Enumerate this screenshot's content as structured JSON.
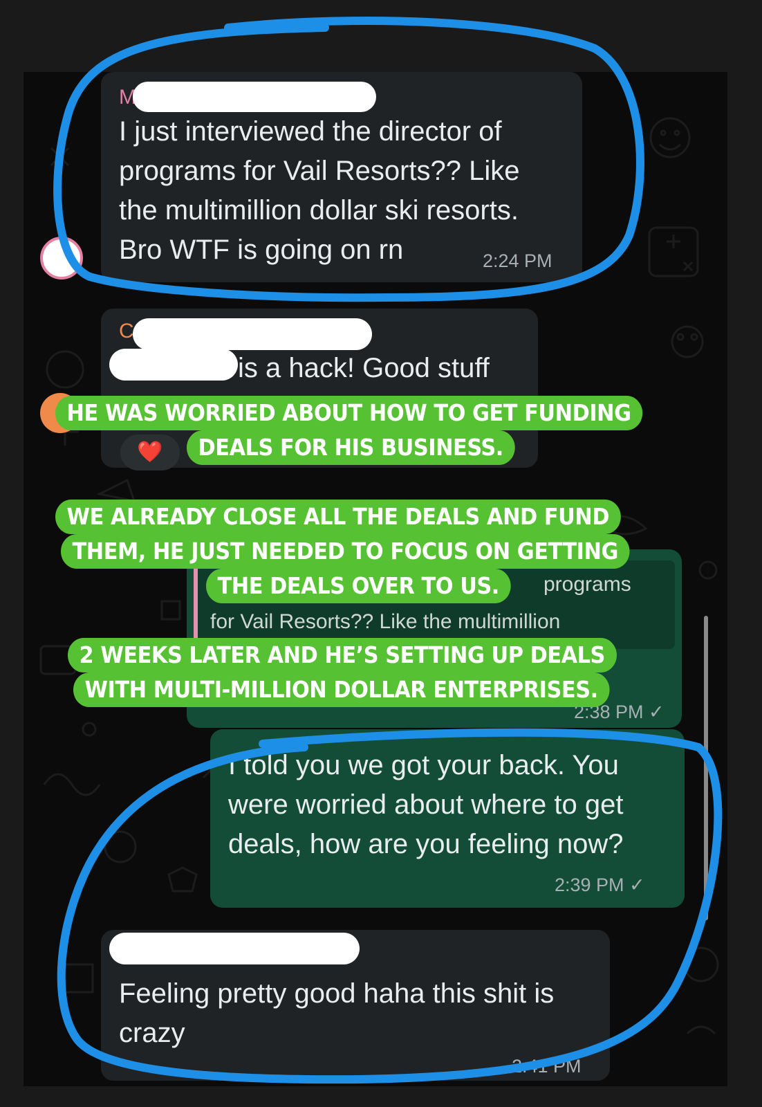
{
  "messages": [
    {
      "sender_initial": "M",
      "lines": [
        "I just interviewed the director of",
        "programs for Vail Resorts?? Like",
        "the multimillion dollar ski resorts.",
        "Bro WTF is going on rn"
      ],
      "time": "2:24 PM"
    },
    {
      "sender_initial": "C",
      "text": "is a hack! Good stuff",
      "reaction": "❤️"
    },
    {
      "quoted_top": "programs",
      "quoted_bottom": "for Vail Resorts?? Like the multimillion",
      "time": "2:38 PM ✓"
    },
    {
      "lines": [
        "I told you we got your back. You",
        "were worried about where to get",
        "deals, how are you feeling now?"
      ],
      "time": "2:39 PM ✓"
    },
    {
      "lines": [
        "Feeling pretty good haha this shit is",
        "crazy"
      ],
      "time": "2:41 PM"
    }
  ],
  "overlays": [
    "HE WAS WORRIED ABOUT HOW TO GET FUNDING",
    "DEALS FOR HIS BUSINESS.",
    "WE ALREADY CLOSE ALL THE DEALS AND FUND",
    "THEM, HE JUST NEEDED TO FOCUS ON GETTING",
    "THE DEALS OVER TO US.",
    "2 WEEKS LATER AND HE’S SETTING UP DEALS",
    "WITH MULTI-MILLION DOLLAR ENTERPRISES."
  ],
  "colors": {
    "annotation_blue": "#1e8fe6",
    "overlay_green": "#56c233",
    "outgoing_bubble": "#134d37",
    "incoming_bubble": "#1f2326"
  }
}
